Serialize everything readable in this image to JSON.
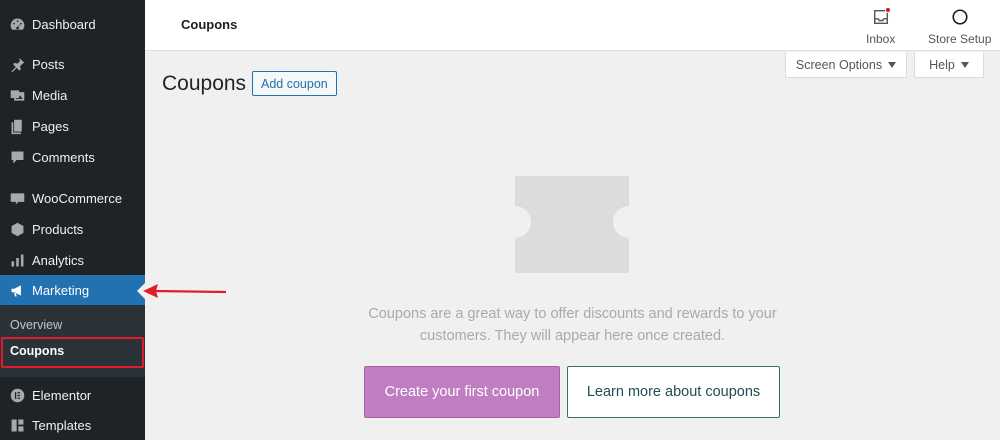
{
  "sidebar": {
    "items": [
      {
        "label": "Dashboard",
        "icon": "dashboard-icon"
      },
      {
        "label": "Posts",
        "icon": "pin-icon"
      },
      {
        "label": "Media",
        "icon": "media-icon"
      },
      {
        "label": "Pages",
        "icon": "pages-icon"
      },
      {
        "label": "Comments",
        "icon": "comment-icon"
      },
      {
        "label": "WooCommerce",
        "icon": "woocommerce-icon"
      },
      {
        "label": "Products",
        "icon": "products-icon"
      },
      {
        "label": "Analytics",
        "icon": "analytics-icon"
      },
      {
        "label": "Marketing",
        "icon": "megaphone-icon",
        "active": true
      },
      {
        "label": "Elementor",
        "icon": "elementor-icon"
      },
      {
        "label": "Templates",
        "icon": "templates-icon"
      }
    ],
    "submenu": [
      {
        "label": "Overview"
      },
      {
        "label": "Coupons",
        "current": true
      }
    ]
  },
  "header": {
    "title": "Coupons",
    "inbox_label": "Inbox",
    "store_setup_label": "Store Setup"
  },
  "tabs": {
    "screen_options": "Screen Options",
    "help": "Help"
  },
  "main": {
    "page_title": "Coupons",
    "add_button": "Add coupon",
    "empty_message_line1": "Coupons are a great way to offer discounts and rewards to your",
    "empty_message_line2": "customers. They will appear here once created.",
    "primary_cta": "Create your first coupon",
    "secondary_cta": "Learn more about coupons"
  },
  "colors": {
    "sidebar_bg": "#1d2327",
    "active_bg": "#2271b1",
    "primary_button": "#c17dc1",
    "annotation_red": "#e11d2b"
  }
}
